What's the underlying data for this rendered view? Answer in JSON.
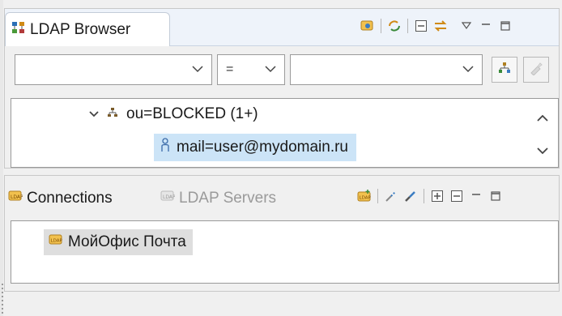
{
  "ldap_browser": {
    "tab_title": "LDAP Browser",
    "tab_icon": "ldap-browser-icon",
    "toolbar_icons": [
      "link-with-editor-icon",
      "refresh-icon",
      "collapse-all-icon",
      "sync-icon",
      "view-menu-icon",
      "minimize-icon",
      "maximize-icon"
    ],
    "filter": {
      "attribute_value": "",
      "operator_value": "=",
      "value_value": ""
    },
    "tree": {
      "parent": {
        "label": "ou=BLOCKED (1+)",
        "expanded": true,
        "icon": "ou-icon"
      },
      "child": {
        "label": "mail=user@mydomain.ru",
        "icon": "entry-icon",
        "selected": true
      }
    }
  },
  "connections_view": {
    "tabs": [
      {
        "label": "Connections",
        "active": true,
        "icon": "connections-icon"
      },
      {
        "label": "LDAP Servers",
        "active": false,
        "icon": "ldap-servers-icon"
      }
    ],
    "toolbar_icons": [
      "new-connection-icon",
      "disconnect-icon",
      "connect-icon",
      "expand-all-icon",
      "collapse-all-icon",
      "minimize-icon",
      "maximize-icon"
    ],
    "items": [
      {
        "label": "МойОфис Почта",
        "icon": "connection-icon",
        "selected": true
      }
    ]
  },
  "colors": {
    "selection": "#cce4f7",
    "tab_bar": "#eef3fa",
    "connection_selection": "#dedede"
  }
}
